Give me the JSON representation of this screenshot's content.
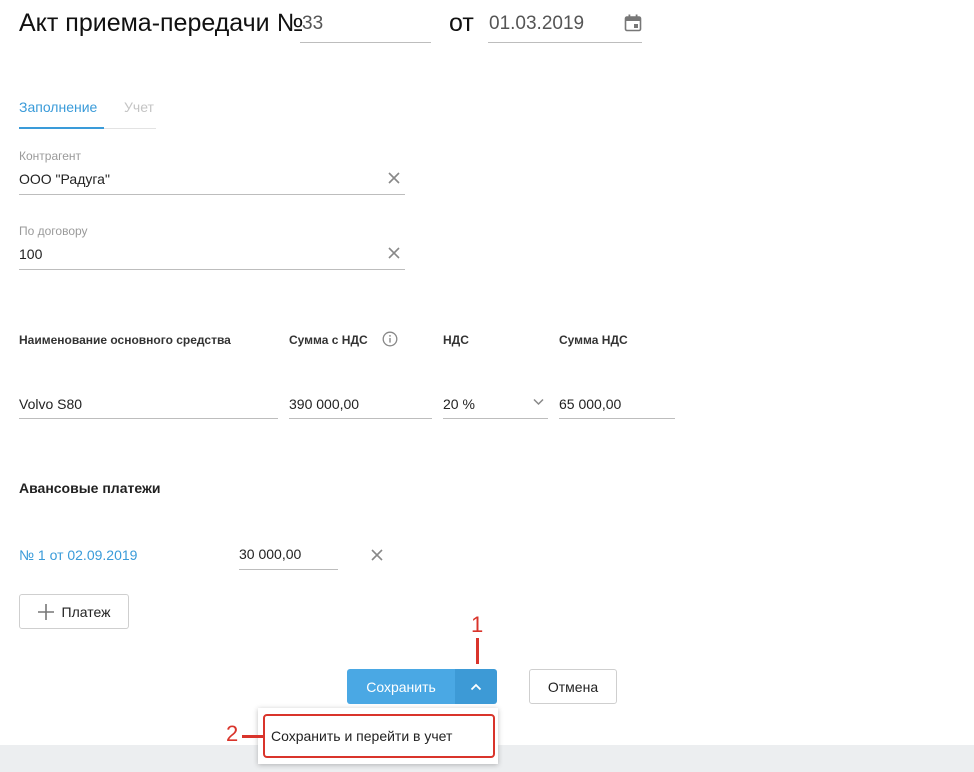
{
  "header": {
    "title": "Акт приема-передачи №",
    "number": "33",
    "date_prefix": "от",
    "date": "01.03.2019"
  },
  "tabs": [
    {
      "label": "Заполнение",
      "active": true
    },
    {
      "label": "Учет",
      "active": false
    }
  ],
  "form": {
    "counterparty_label": "Контрагент",
    "counterparty_value": "ООО \"Радуга\"",
    "contract_label": "По договору",
    "contract_value": "100"
  },
  "assets_table": {
    "headers": [
      "Наименование основного средства",
      "Сумма с НДС",
      "НДС",
      "Сумма НДС"
    ],
    "row": {
      "name": "Volvo S80",
      "sum_with_vat": "390 000,00",
      "vat_rate": "20 %",
      "vat_sum": "65 000,00"
    }
  },
  "advances": {
    "title": "Авансовые платежи",
    "items": [
      {
        "link": "№ 1 от 02.09.2019",
        "amount": "30 000,00"
      }
    ],
    "add_button_label": "Платеж"
  },
  "actions": {
    "save_label": "Сохранить",
    "cancel_label": "Отмена",
    "dropdown_item": "Сохранить и перейти в учет"
  },
  "annotations": {
    "marker1": "1",
    "marker2": "2"
  },
  "colors": {
    "accent": "#3a9bd9",
    "primary_button": "#4aa8e4",
    "primary_button_dark": "#3d9ad6",
    "highlight": "#d9342b"
  }
}
